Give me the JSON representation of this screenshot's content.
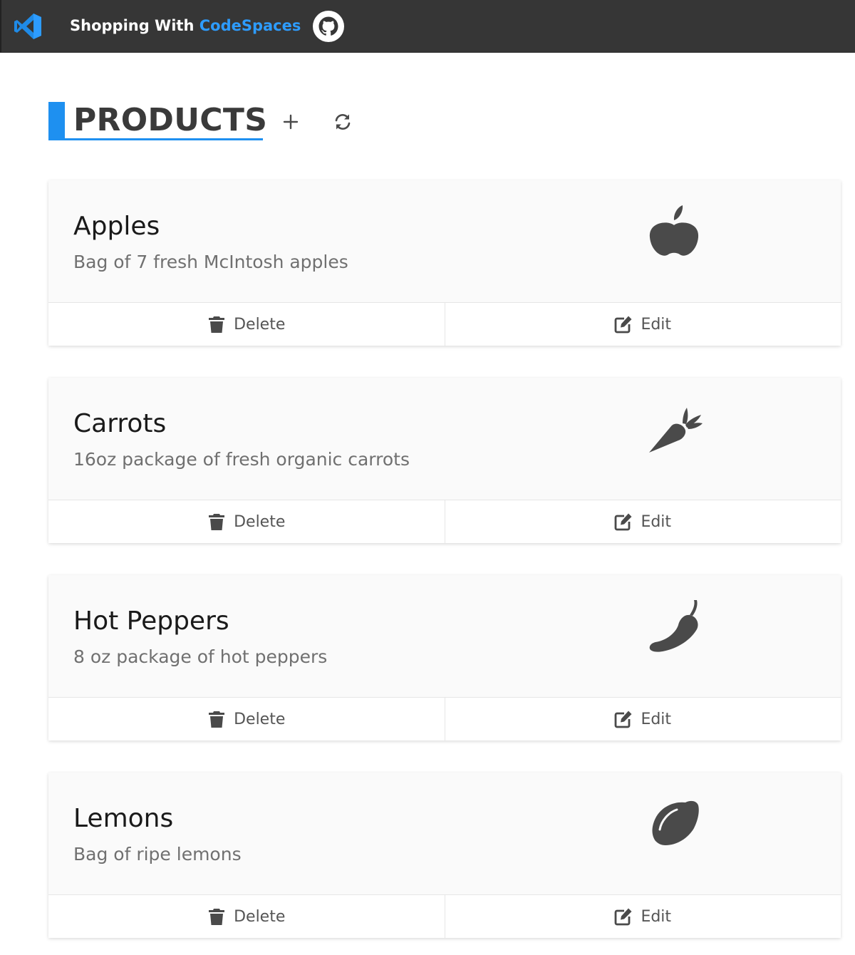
{
  "header": {
    "brand_prefix": "Shopping With ",
    "brand_accent": "CodeSpaces",
    "logo_icon": "vscode-icon",
    "github_icon": "github-icon"
  },
  "page": {
    "title": "PRODUCTS",
    "add_icon": "plus-icon",
    "refresh_icon": "sync-icon"
  },
  "colors": {
    "topbar": "#363636",
    "accent": "#1e90f0",
    "brand_accent": "#2d9cff",
    "icon": "#4a4a4a",
    "card_bg": "#fafafa"
  },
  "products": [
    {
      "name": "Apples",
      "description": "Bag of 7 fresh McIntosh apples",
      "icon": "apple-icon",
      "delete_label": "Delete",
      "edit_label": "Edit"
    },
    {
      "name": "Carrots",
      "description": "16oz package of fresh organic carrots",
      "icon": "carrot-icon",
      "delete_label": "Delete",
      "edit_label": "Edit"
    },
    {
      "name": "Hot Peppers",
      "description": "8 oz package of hot peppers",
      "icon": "pepper-hot-icon",
      "delete_label": "Delete",
      "edit_label": "Edit"
    },
    {
      "name": "Lemons",
      "description": "Bag of ripe lemons",
      "icon": "lemon-icon",
      "delete_label": "Delete",
      "edit_label": "Edit"
    }
  ]
}
